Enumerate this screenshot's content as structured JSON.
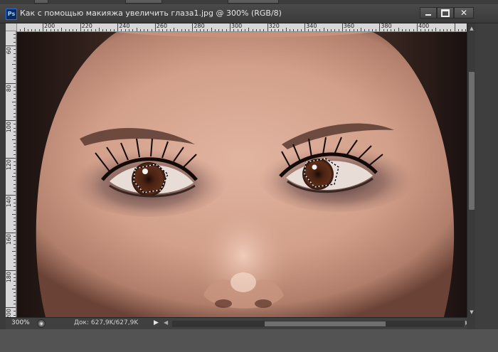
{
  "window": {
    "app_icon": "Ps",
    "title": "Как с помощью макияжа увеличить глаза1.jpg @ 300% (RGB/8)"
  },
  "controls": {
    "minimize_icon": "minimize-icon",
    "maximize_icon": "maximize-icon",
    "close_icon": "close-icon",
    "close_glyph": "✕"
  },
  "ruler": {
    "horizontal_labels": [
      "200",
      "220",
      "240",
      "260",
      "280",
      "300",
      "320",
      "340",
      "360",
      "380",
      "400"
    ],
    "vertical_labels": [
      "60",
      "80",
      "100",
      "120",
      "140",
      "160",
      "180",
      "200"
    ]
  },
  "canvas": {
    "image_subject": "close-up of eyes with makeup and marching-ants selection around both irises"
  },
  "status": {
    "zoom": "300%",
    "doc_info": "Док: 627,9K/627,9K",
    "play_glyph": "▶",
    "scroll_left_glyph": "◀",
    "scroll_right_glyph": "▶"
  }
}
